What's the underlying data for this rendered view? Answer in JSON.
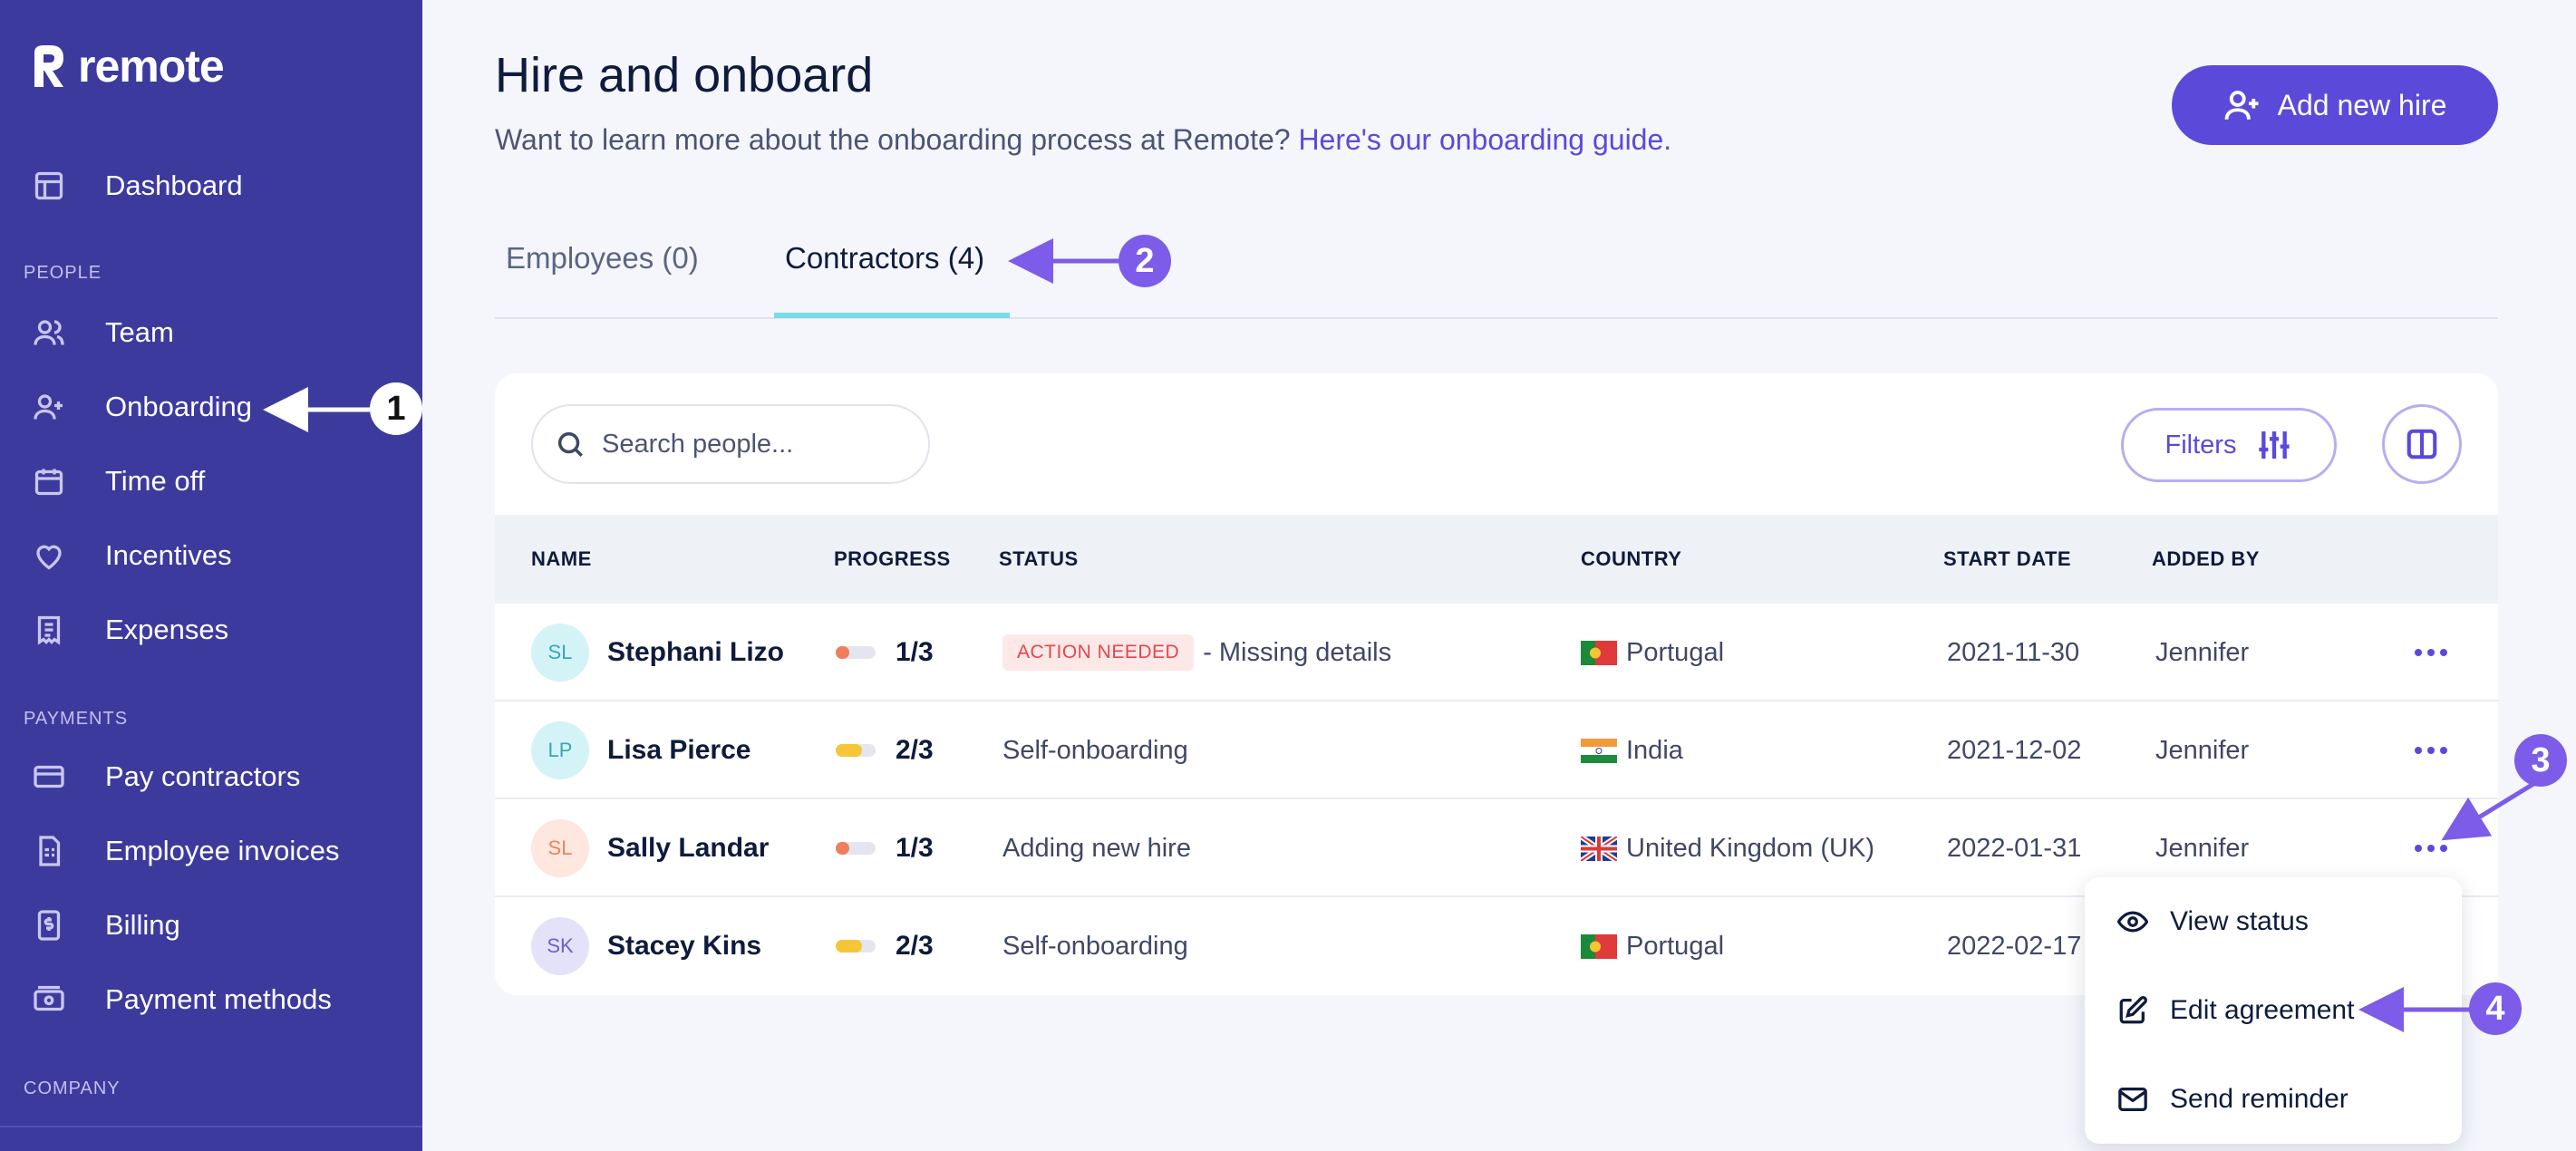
{
  "sidebar": {
    "brand": "remote",
    "dashboard": "Dashboard",
    "section_people": "PEOPLE",
    "team": "Team",
    "onboarding": "Onboarding",
    "time_off": "Time off",
    "incentives": "Incentives",
    "expenses": "Expenses",
    "section_payments": "PAYMENTS",
    "pay_contractors": "Pay contractors",
    "employee_invoices": "Employee invoices",
    "billing": "Billing",
    "payment_methods": "Payment methods",
    "section_company": "COMPANY"
  },
  "header": {
    "title": "Hire and onboard",
    "subtitle": "Want to learn more about the onboarding process at Remote?",
    "guide_link": "Here's our onboarding guide.",
    "add_button": "Add new hire"
  },
  "tabs": {
    "employees": "Employees (0)",
    "contractors": "Contractors (4)"
  },
  "toolbar": {
    "search_placeholder": "Search people...",
    "filters": "Filters"
  },
  "table": {
    "headers": {
      "name": "NAME",
      "progress": "PROGRESS",
      "status": "STATUS",
      "country": "COUNTRY",
      "start_date": "START DATE",
      "added_by": "ADDED BY"
    },
    "rows": [
      {
        "initials": "SL",
        "name": "Stephani Lizo",
        "progress": "1/3",
        "progress_fraction": 0.33,
        "badge": "ACTION NEEDED",
        "status": "- Missing details",
        "country": "Portugal",
        "start_date": "2021-11-30",
        "added_by": "Jennifer"
      },
      {
        "initials": "LP",
        "name": "Lisa Pierce",
        "progress": "2/3",
        "progress_fraction": 0.67,
        "badge": "",
        "status": "Self-onboarding",
        "country": "India",
        "start_date": "2021-12-02",
        "added_by": "Jennifer"
      },
      {
        "initials": "SL",
        "name": "Sally Landar",
        "progress": "1/3",
        "progress_fraction": 0.33,
        "badge": "",
        "status": "Adding new hire",
        "country": "United Kingdom (UK)",
        "start_date": "2022-01-31",
        "added_by": "Jennifer"
      },
      {
        "initials": "SK",
        "name": "Stacey Kins",
        "progress": "2/3",
        "progress_fraction": 0.67,
        "badge": "",
        "status": "Self-onboarding",
        "country": "Portugal",
        "start_date": "2022-02-17",
        "added_by": ""
      }
    ]
  },
  "row_menu": {
    "view_status": "View status",
    "edit_agreement": "Edit agreement",
    "send_reminder": "Send reminder"
  },
  "annotations": {
    "step1": "1",
    "step2": "2",
    "step3": "3",
    "step4": "4"
  },
  "colors": {
    "sidebar": "#3d3a9e",
    "accent": "#5b4ad9",
    "tab_underline": "#7adbe6",
    "annotation": "#7c5ce8"
  }
}
